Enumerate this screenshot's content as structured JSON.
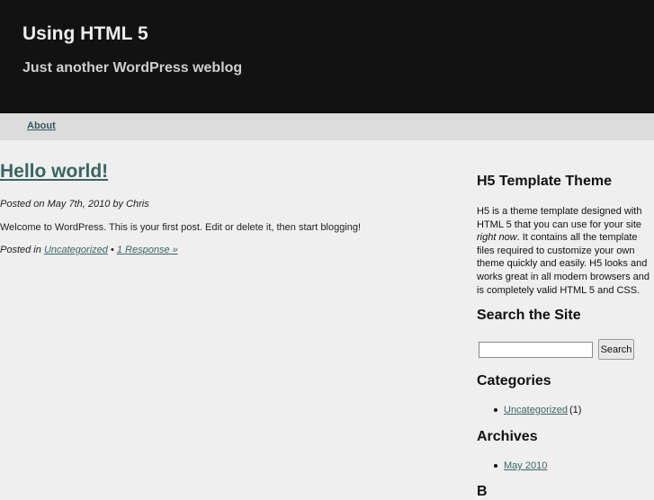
{
  "header": {
    "title": "Using HTML 5",
    "tagline": "Just another WordPress weblog"
  },
  "nav": {
    "items": [
      {
        "label": "About"
      }
    ]
  },
  "post": {
    "title": "Hello world!",
    "meta_posted_on": "Posted on",
    "meta_date": "May 7th, 2010",
    "meta_by": "by",
    "meta_author": "Chris",
    "body": "Welcome to WordPress. This is your first post. Edit or delete it, then start blogging!",
    "footer_label": "Posted in",
    "category": "Uncategorized",
    "separator": "•",
    "responses": "1 Response »"
  },
  "sidebar": {
    "about_title": "H5 Template Theme",
    "about_text_1": "H5 is a theme template designed with HTML 5 that you can use for your site ",
    "about_text_em": "right now",
    "about_text_2": ". It contains all the template files required to customize your own theme quickly and easily. H5 looks and works great in all modern browsers and is completely valid HTML 5 and CSS.",
    "search_title": "Search the Site",
    "search_value": "",
    "search_button": "Search",
    "categories_title": "Categories",
    "categories": [
      {
        "label": "Uncategorized",
        "count": "(1)"
      }
    ],
    "archives_title": "Archives",
    "archives": [
      {
        "label": "May 2010"
      }
    ],
    "next_title_partial": "B"
  },
  "colors": {
    "header_bg": "#121212",
    "nav_bg": "#dcdcdc",
    "page_bg": "#efefef",
    "link": "#3b6464"
  }
}
